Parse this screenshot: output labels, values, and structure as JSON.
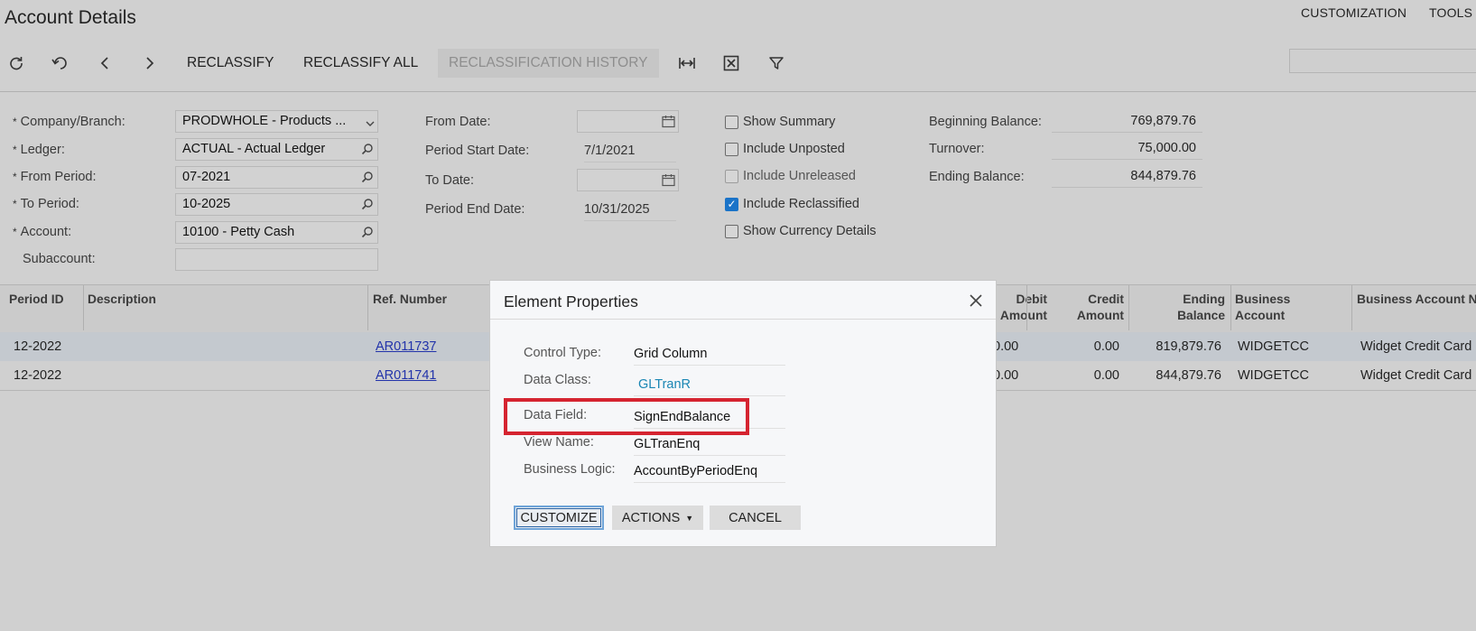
{
  "header": {
    "title": "Account Details",
    "links": [
      "CUSTOMIZATION",
      "TOOLS"
    ]
  },
  "toolbar": {
    "icons": [
      "refresh-icon",
      "undo-icon",
      "chevron-left-icon",
      "chevron-right-icon"
    ],
    "reclassify": "RECLASSIFY",
    "reclassify_all": "RECLASSIFY ALL",
    "reclassification_history": "RECLASSIFICATION HISTORY",
    "right_icons": [
      "fit-columns-icon",
      "excel-export-icon",
      "filter-icon"
    ]
  },
  "form": {
    "company_branch": {
      "label": "Company/Branch:",
      "value": "PRODWHOLE - Products ..."
    },
    "ledger": {
      "label": "Ledger:",
      "value": "ACTUAL - Actual Ledger"
    },
    "from_period": {
      "label": "From Period:",
      "value": "07-2021"
    },
    "to_period": {
      "label": "To Period:",
      "value": "10-2025"
    },
    "account": {
      "label": "Account:",
      "value": "10100 - Petty Cash"
    },
    "subaccount": {
      "label": "Subaccount:",
      "value": ""
    },
    "from_date": {
      "label": "From Date:",
      "value": ""
    },
    "period_start_date": {
      "label": "Period Start Date:",
      "value": "7/1/2021"
    },
    "to_date": {
      "label": "To Date:",
      "value": ""
    },
    "period_end_date": {
      "label": "Period End Date:",
      "value": "10/31/2025"
    },
    "required_mark": "*"
  },
  "checkboxes": [
    {
      "label": "Show Summary",
      "checked": false,
      "disabled": false
    },
    {
      "label": "Include Unposted",
      "checked": false,
      "disabled": false
    },
    {
      "label": "Include Unreleased",
      "checked": false,
      "disabled": true
    },
    {
      "label": "Include Reclassified",
      "checked": true,
      "disabled": false
    },
    {
      "label": "Show Currency Details",
      "checked": false,
      "disabled": false
    }
  ],
  "balances": {
    "beginning": {
      "label": "Beginning Balance:",
      "value": "769,879.76"
    },
    "turnover": {
      "label": "Turnover:",
      "value": "75,000.00"
    },
    "ending": {
      "label": "Ending Balance:",
      "value": "844,879.76"
    }
  },
  "grid": {
    "columns": {
      "period_id": "Period ID",
      "description": "Description",
      "ref_number": "Ref. Number",
      "debit_1": "Debit",
      "debit_2": "Amount",
      "credit_1": "Credit",
      "credit_2": "Amount",
      "ending_1": "Ending",
      "ending_2": "Balance",
      "business_1": "Business",
      "business_2": "Account",
      "business_account_name": "Business Account Na"
    },
    "rows": [
      {
        "period": "12-2022",
        "ref": "AR011737",
        "debit": "0.00",
        "credit": "0.00",
        "ending": "819,879.76",
        "business": "WIDGETCC",
        "name": "Widget Credit Card"
      },
      {
        "period": "12-2022",
        "ref": "AR011741",
        "debit": "0.00",
        "credit": "0.00",
        "ending": "844,879.76",
        "business": "WIDGETCC",
        "name": "Widget Credit Card"
      }
    ]
  },
  "modal": {
    "title": "Element Properties",
    "control_type": {
      "label": "Control Type:",
      "value": "Grid Column"
    },
    "data_class": {
      "label": "Data Class:",
      "value": "GLTranR"
    },
    "data_field": {
      "label": "Data Field:",
      "value": "SignEndBalance"
    },
    "view_name": {
      "label": "View Name:",
      "value": "GLTranEnq"
    },
    "business_logic": {
      "label": "Business Logic:",
      "value": "AccountByPeriodEnq"
    },
    "buttons": {
      "customize": "CUSTOMIZE",
      "actions": "ACTIONS",
      "cancel": "CANCEL"
    }
  },
  "colors": {
    "highlight_border": "#d52430",
    "link": "#2233aa",
    "checkbox_checked": "#1a73c8"
  }
}
